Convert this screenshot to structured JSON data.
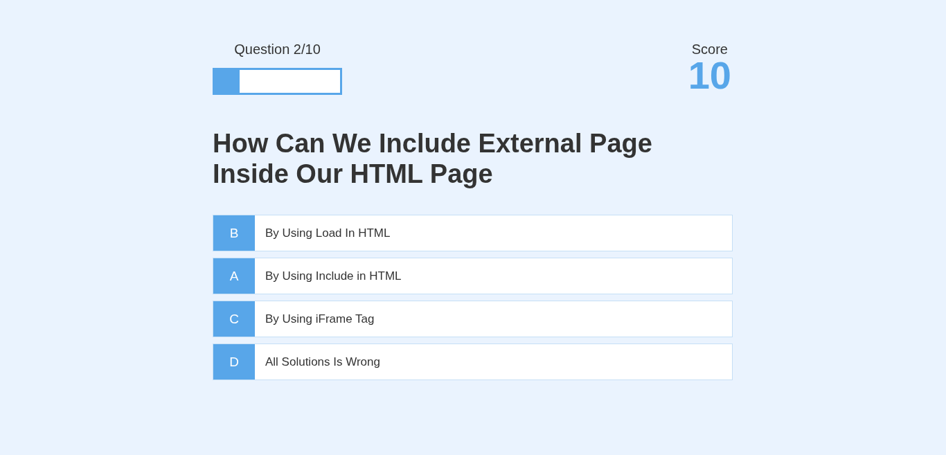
{
  "progress": {
    "label": "Question 2/10",
    "level": 0.2
  },
  "score": {
    "label": "Score",
    "value": "10"
  },
  "question": "How Can We Include External Page Inside Our HTML Page",
  "answers": [
    {
      "letter": "B",
      "text": "By Using Load In HTML"
    },
    {
      "letter": "A",
      "text": "By Using Include in HTML"
    },
    {
      "letter": "C",
      "text": "By Using iFrame Tag"
    },
    {
      "letter": "D",
      "text": "All Solutions Is Wrong"
    }
  ]
}
